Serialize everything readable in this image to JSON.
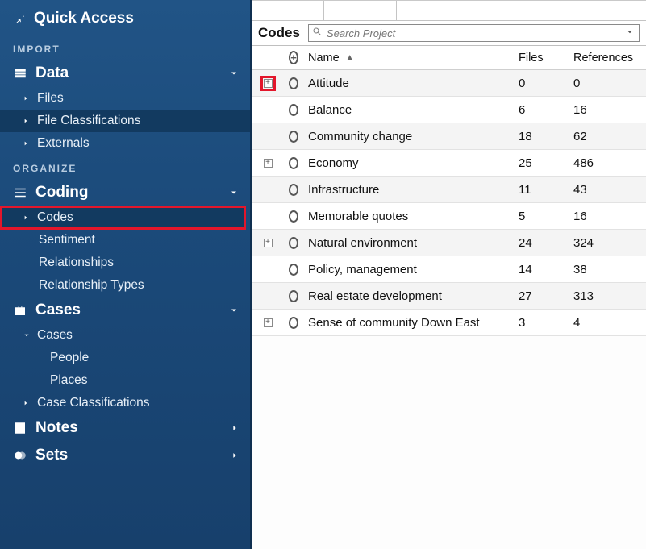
{
  "sidebar": {
    "quick_access": "Quick Access",
    "import_label": "IMPORT",
    "organize_label": "ORGANIZE",
    "data": {
      "title": "Data",
      "items": [
        "Files",
        "File Classifications",
        "Externals"
      ]
    },
    "coding": {
      "title": "Coding",
      "items": [
        "Codes",
        "Sentiment",
        "Relationships",
        "Relationship Types"
      ]
    },
    "cases": {
      "title": "Cases",
      "parent": "Cases",
      "children": [
        "People",
        "Places"
      ],
      "extra": "Case Classifications"
    },
    "notes": "Notes",
    "sets": "Sets"
  },
  "main": {
    "panel_title": "Codes",
    "search_placeholder": "Search Project",
    "columns": {
      "name": "Name",
      "files": "Files",
      "refs": "References"
    },
    "rows": [
      {
        "name": "Attitude",
        "files": "0",
        "refs": "0",
        "expandable": true,
        "highlight": true
      },
      {
        "name": "Balance",
        "files": "6",
        "refs": "16",
        "expandable": false
      },
      {
        "name": "Community change",
        "files": "18",
        "refs": "62",
        "expandable": false
      },
      {
        "name": "Economy",
        "files": "25",
        "refs": "486",
        "expandable": true
      },
      {
        "name": "Infrastructure",
        "files": "11",
        "refs": "43",
        "expandable": false
      },
      {
        "name": "Memorable quotes",
        "files": "5",
        "refs": "16",
        "expandable": false
      },
      {
        "name": "Natural environment",
        "files": "24",
        "refs": "324",
        "expandable": true
      },
      {
        "name": "Policy, management",
        "files": "14",
        "refs": "38",
        "expandable": false
      },
      {
        "name": "Real estate development",
        "files": "27",
        "refs": "313",
        "expandable": false
      },
      {
        "name": "Sense of community Down East",
        "files": "3",
        "refs": "4",
        "expandable": true
      }
    ]
  }
}
